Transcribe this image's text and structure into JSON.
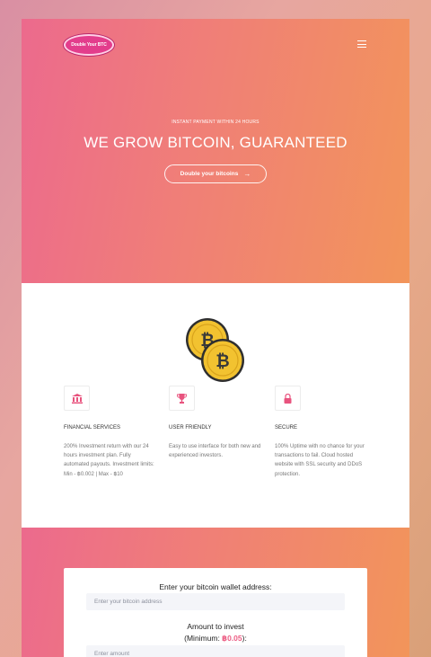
{
  "hero": {
    "logo_text": "Double Your BTC",
    "kicker": "INSTANT PAYMENT WITHIN 24 HOURS",
    "headline": "WE GROW BITCOIN, GUARANTEED",
    "cta_label": "Double your bitcoins",
    "cta_arrow": "→"
  },
  "features": [
    {
      "icon": "bank-icon",
      "title": "FINANCIAL SERVICES",
      "desc": "200% Investment return with our 24 hours investment plan. Fully automated payouts. Investment limits: Min - ฿0.002 | Max - ฿10"
    },
    {
      "icon": "trophy-icon",
      "title": "USER FRIENDLY",
      "desc": "Easy to use interface for both new and experienced investors."
    },
    {
      "icon": "lock-icon",
      "title": "SECURE",
      "desc": "100% Uptime with no chance for your transactions to fail. Cloud hosted website with SSL security and DDoS protection."
    }
  ],
  "invest": {
    "wallet_label": "Enter your bitcoin wallet address:",
    "wallet_placeholder": "Enter your bitcoin address",
    "amount_label": "Amount to invest",
    "min_prefix": "(Minimum: ",
    "min_value": "฿0.05",
    "min_suffix": "):",
    "amount_placeholder": "Enter amount"
  },
  "colors": {
    "gradient_start": "#ec6a8d",
    "gradient_end": "#f2955a",
    "accent": "#ec5e84",
    "coin": "#f2c230"
  }
}
